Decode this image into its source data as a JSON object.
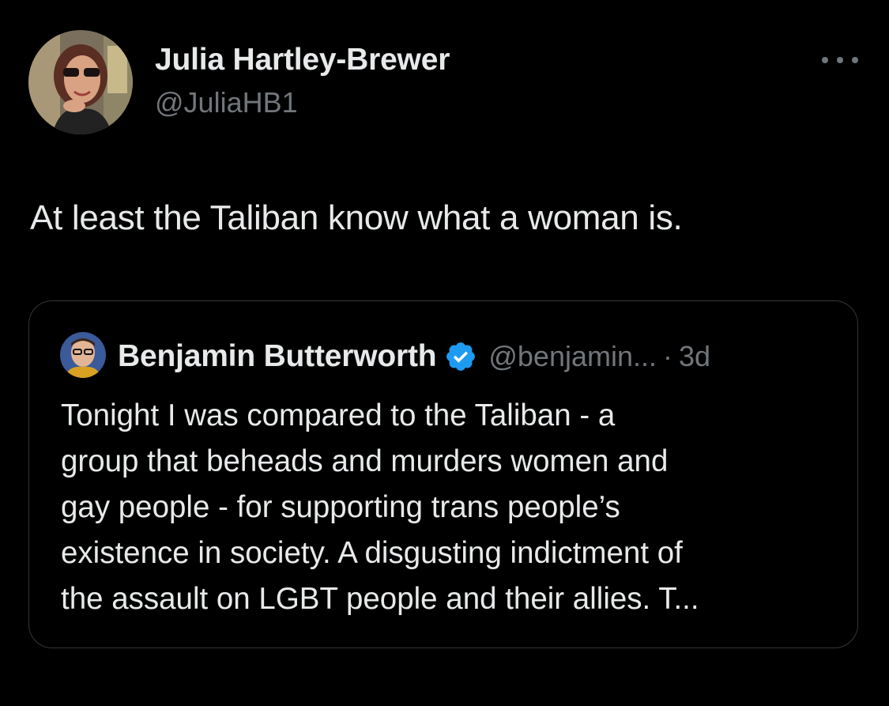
{
  "tweet": {
    "author": {
      "name": "Julia Hartley-Brewer",
      "handle": "@JuliaHB1",
      "avatar_icon": "profile-photo"
    },
    "more_icon": "more-options-icon",
    "text": "At least the Taliban know what a woman is.",
    "quoted_tweet": {
      "author": {
        "name": "Benjamin Butterworth",
        "handle": "@benjamin...",
        "verified": true,
        "avatar_icon": "profile-photo"
      },
      "separator": "·",
      "time": "3d",
      "text_lines": [
        "Tonight I was compared to the Taliban - a",
        "group that beheads and murders women and",
        "gay people - for supporting trans people’s",
        "existence in society. A disgusting indictment of",
        "the assault on LGBT people and their allies. T..."
      ]
    }
  },
  "colors": {
    "background": "#000000",
    "primary_text": "#e7e9ea",
    "secondary_text": "#71767b",
    "card_border": "#333639",
    "verified_blue": "#1d9bf0"
  }
}
